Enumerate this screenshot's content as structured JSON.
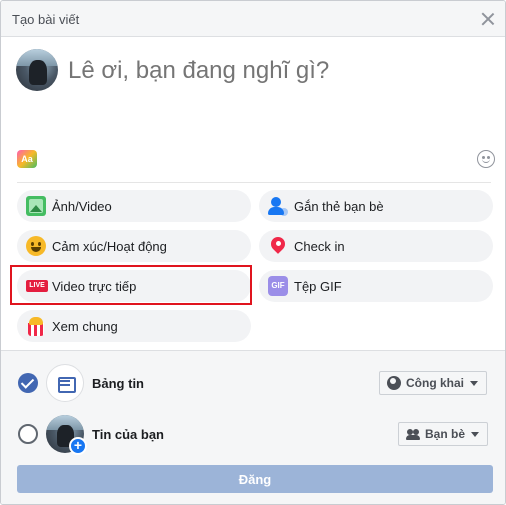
{
  "header": {
    "title": "Tạo bài viết"
  },
  "composer": {
    "placeholder": "Lê ơi, bạn đang nghĩ gì?",
    "text_bg_label": "Aa"
  },
  "options": [
    {
      "label": "Ảnh/Video",
      "icon": "photo-video-icon"
    },
    {
      "label": "Gắn thẻ bạn bè",
      "icon": "tag-friends-icon"
    },
    {
      "label": "Cảm xúc/Hoạt động",
      "icon": "feeling-icon"
    },
    {
      "label": "Check in",
      "icon": "location-pin-icon"
    },
    {
      "label": "Video trực tiếp",
      "icon": "live-video-icon",
      "live_badge": "LIVE"
    },
    {
      "label": "Tệp GIF",
      "icon": "gif-icon",
      "gif_badge": "GIF"
    },
    {
      "label": "Xem chung",
      "icon": "watch-party-icon"
    }
  ],
  "share": {
    "news_feed": {
      "label": "Bảng tin",
      "checked": true,
      "privacy": "Công khai"
    },
    "story": {
      "label": "Tin của bạn",
      "checked": false,
      "privacy": "Bạn bè"
    }
  },
  "post_button": {
    "label": "Đăng"
  },
  "colors": {
    "accent": "#4267b2",
    "highlight": "#e0141e",
    "post_disabled": "#9cb4d8"
  }
}
